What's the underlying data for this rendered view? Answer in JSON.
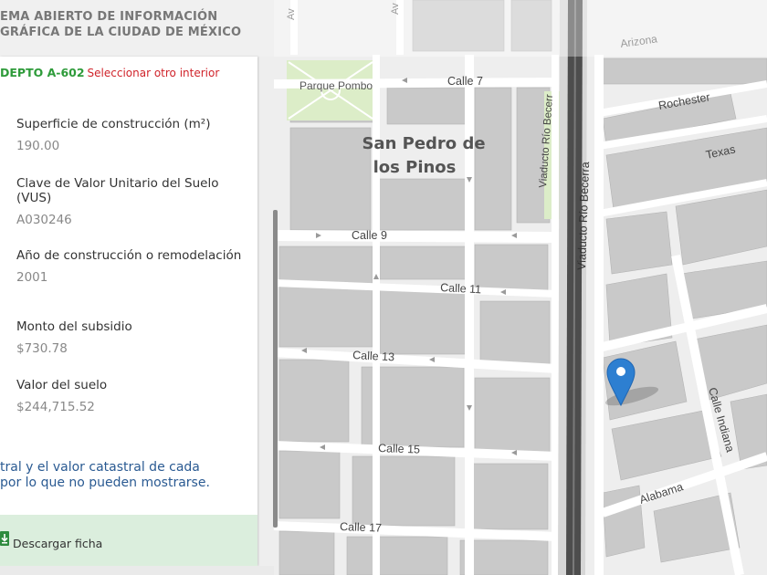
{
  "header": {
    "line1": "EMA ABIERTO DE INFORMACIÓN",
    "line2": "GRÁFICA DE LA CIUDAD DE MÉXICO"
  },
  "panel": {
    "unit": "DEPTO A-602",
    "select_other": "Seleccionar otro interior",
    "fields": [
      {
        "label": "Superficie de construcción (m²)",
        "value": "190.00"
      },
      {
        "label": "Clave de Valor Unitario del Suelo (VUS)",
        "value": "A030246"
      },
      {
        "label": "Año de construcción o remodelación",
        "value": "2001"
      },
      {
        "label": "Monto del subsidio",
        "value": "$730.78"
      },
      {
        "label": "Valor del suelo",
        "value": "$244,715.52"
      }
    ],
    "note_line1": "tral y el valor catastral de cada",
    "note_line2": "por lo que no pueden mostrarse.",
    "download_label": "Descargar ficha",
    "icons": {
      "download": "download-icon",
      "marker": "location-pin-icon"
    }
  },
  "map": {
    "colors": {
      "block": "#c9c9c9",
      "road": "#ffffff",
      "park": "#dcedc8",
      "highway": "#5a5a5a",
      "marker": "#2d7fd1"
    },
    "labels": {
      "neighborhood_line1": "San Pedro de",
      "neighborhood_line2": "los Pinos",
      "park": "Parque Pombo",
      "calle7": "Calle 7",
      "calle9": "Calle 9",
      "calle11": "Calle 11",
      "calle13": "Calle 13",
      "calle15": "Calle 15",
      "calle17": "Calle 17",
      "rochester": "Rochester",
      "texas": "Texas",
      "arizona": "Arizona",
      "viaducto_becerra": "Viaducto Río Becerra",
      "viaducto_becerra_short": "Viaducto Río Becerr",
      "calle_indiana": "Calle Indiana",
      "alabama": "Alabama",
      "av_left": "Av",
      "av_right": "Av"
    }
  }
}
